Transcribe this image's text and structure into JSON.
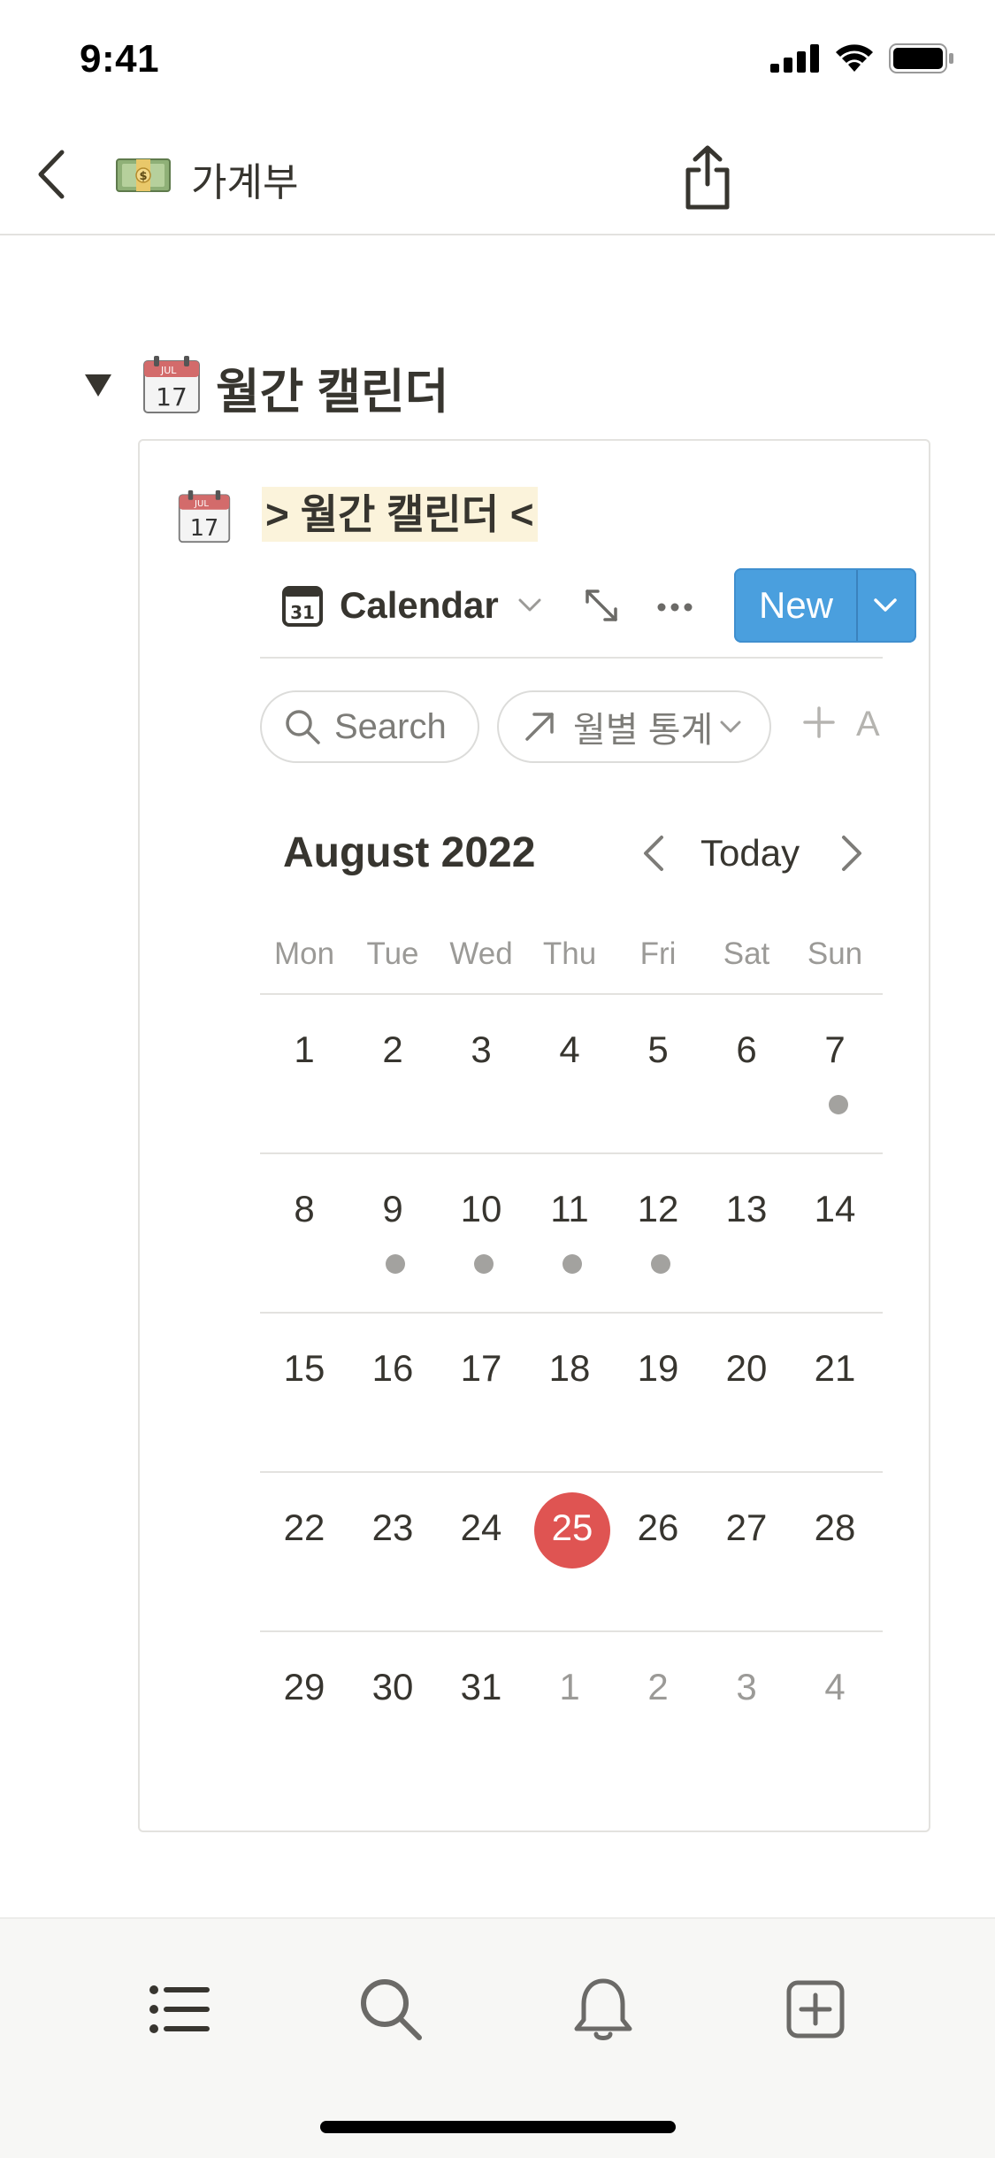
{
  "status_bar": {
    "time": "9:41"
  },
  "nav": {
    "title": "가계부",
    "page_icon": "money-emoji-icon"
  },
  "section": {
    "title": "월간 캘린더",
    "icon": "calendar-emoji-icon"
  },
  "database": {
    "title": "> 월간 캘린더 <",
    "view_label": "Calendar",
    "new_button_label": "New"
  },
  "filters": {
    "search_label": "Search",
    "linked_view_label": "월별 통계",
    "add_label": "A"
  },
  "calendar": {
    "month_title": "August 2022",
    "today_label": "Today",
    "weekdays": [
      "Mon",
      "Tue",
      "Wed",
      "Thu",
      "Fri",
      "Sat",
      "Sun"
    ],
    "weeks": [
      [
        "1",
        "2",
        "3",
        "4",
        "5",
        "6",
        "7"
      ],
      [
        "8",
        "9",
        "10",
        "11",
        "12",
        "13",
        "14"
      ],
      [
        "15",
        "16",
        "17",
        "18",
        "19",
        "20",
        "21"
      ],
      [
        "22",
        "23",
        "24",
        "25",
        "26",
        "27",
        "28"
      ],
      [
        "29",
        "30",
        "31",
        "1",
        "2",
        "3",
        "4"
      ]
    ],
    "today": "25",
    "days_with_entries": [
      "7",
      "9",
      "10",
      "11",
      "12"
    ],
    "next_month_days_in_last_week": [
      "1",
      "2",
      "3",
      "4"
    ]
  },
  "tabbar": {
    "items": [
      "list-icon",
      "search-icon",
      "bell-icon",
      "new-page-icon"
    ]
  },
  "colors": {
    "accent_blue": "#4a9fde",
    "today_red": "#df5452",
    "title_highlight": "#fbf3db",
    "text": "#37352f"
  }
}
